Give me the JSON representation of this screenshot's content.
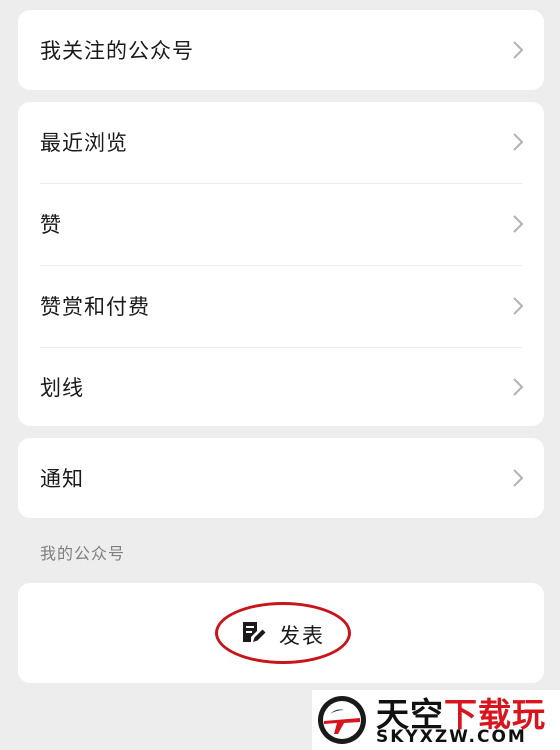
{
  "menu": {
    "followed": {
      "label": "我关注的公众号"
    },
    "group2": [
      {
        "label": "最近浏览"
      },
      {
        "label": "赞"
      },
      {
        "label": "赞赏和付费"
      },
      {
        "label": "划线"
      }
    ],
    "notify": {
      "label": "通知"
    }
  },
  "my_accounts": {
    "section_title": "我的公众号",
    "publish_label": "发表",
    "publish_icon": "edit-document-icon",
    "highlight_color": "#c8141b"
  },
  "watermark": {
    "title_black": "天空",
    "title_red": "下载玩",
    "subtitle": "SKYXZW.COM",
    "logo_icon": "airplane-logo-icon",
    "accent_color": "#d8141c"
  },
  "icons": {
    "chevron": "chevron-right-icon"
  }
}
